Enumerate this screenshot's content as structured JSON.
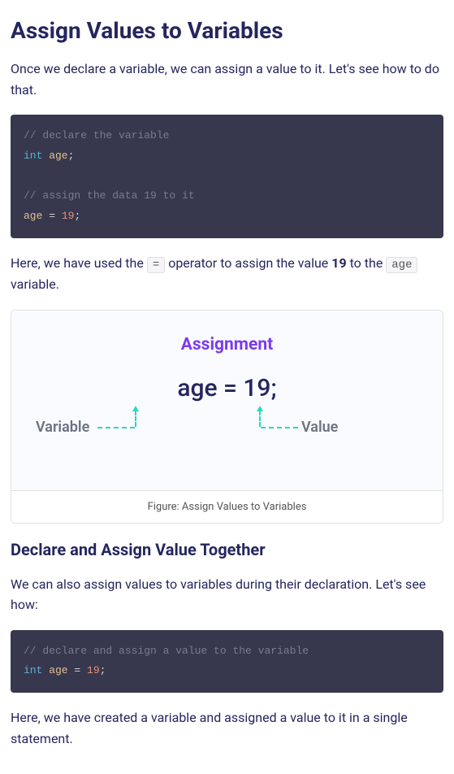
{
  "heading": "Assign Values to Variables",
  "intro": "Once we declare a variable, we can assign a value to it. Let's see how to do that.",
  "code1": {
    "c1": "// declare the variable",
    "kw1": "int",
    "v1": " age",
    "p1": ";",
    "c2": "// assign the data 19 to it",
    "v2": "age ",
    "p2": "= ",
    "n1": "19",
    "p3": ";"
  },
  "para1": {
    "t1": "Here, we have used the ",
    "op": "=",
    "t2": " operator to assign the value ",
    "val": "19",
    "t3": " to the ",
    "var": "age",
    "t4": " variable."
  },
  "figure": {
    "title": "Assignment",
    "expr": "age  =  19;",
    "label_variable": "Variable",
    "label_value": "Value",
    "caption": "Figure: Assign Values to Variables"
  },
  "heading2": "Declare and Assign Value Together",
  "para2": "We can also assign values to variables during their declaration. Let's see how:",
  "code2": {
    "c1": "// declare and assign a value to the variable",
    "kw1": "int",
    "v1": " age ",
    "p1": "= ",
    "n1": "19",
    "p2": ";"
  },
  "para3": "Here, we have created a variable and assigned a value to it in a single statement."
}
